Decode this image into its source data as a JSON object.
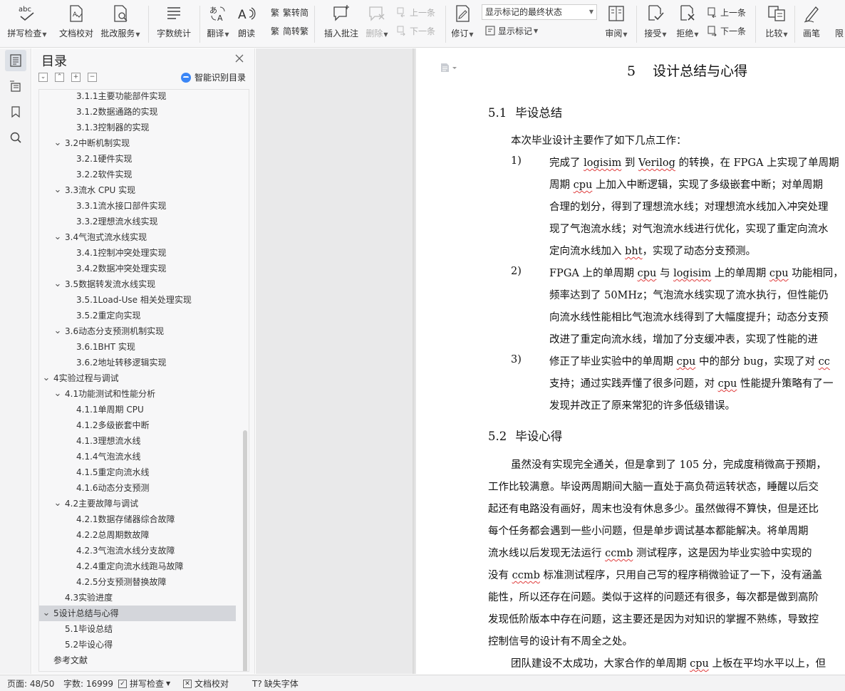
{
  "ribbon": {
    "buttons": [
      {
        "id": "spell",
        "label": "拼写检查",
        "caret": true,
        "icon": "spellcheck-icon"
      },
      {
        "id": "proof",
        "label": "文档校对",
        "caret": false,
        "icon": "document-proofread-icon"
      },
      {
        "id": "review_service",
        "label": "批改服务",
        "caret": true,
        "icon": "review-service-icon"
      },
      {
        "id": "word_count",
        "label": "字数统计",
        "caret": false,
        "icon": "word-count-icon"
      },
      {
        "id": "translate",
        "label": "翻译",
        "caret": true,
        "icon": "translate-icon"
      },
      {
        "id": "read_aloud",
        "label": "朗读",
        "caret": false,
        "icon": "read-aloud-icon"
      },
      {
        "id": "insert_comment",
        "label": "插入批注",
        "caret": false,
        "icon": "insert-comment-icon"
      },
      {
        "id": "delete",
        "label": "删除",
        "caret": true,
        "icon": "delete-comment-icon",
        "disabled": true
      },
      {
        "id": "track",
        "label": "修订",
        "caret": true,
        "icon": "track-changes-icon"
      },
      {
        "id": "review",
        "label": "审阅",
        "caret": true,
        "icon": "review-pane-icon"
      },
      {
        "id": "accept",
        "label": "接受",
        "caret": true,
        "icon": "accept-change-icon"
      },
      {
        "id": "reject",
        "label": "拒绝",
        "caret": true,
        "icon": "reject-change-icon"
      },
      {
        "id": "compare",
        "label": "比较",
        "caret": true,
        "icon": "compare-icon"
      },
      {
        "id": "pen",
        "label": "画笔",
        "caret": false,
        "icon": "pen-icon"
      },
      {
        "id": "restrict",
        "label": "限",
        "caret": false,
        "icon": ""
      }
    ],
    "trad": "繁转简",
    "simp": "简转繁",
    "prev_comment": "上一条",
    "next_comment": "下一条",
    "markup_select": "显示标记的最终状态",
    "show_markup": "显示标记",
    "prev_change": "上一条",
    "next_change": "下一条"
  },
  "toc": {
    "title": "目录",
    "smart_label": "智能识别目录",
    "ctrl": [
      "collapse-all",
      "expand-up",
      "add-heading",
      "remove-heading"
    ],
    "items": [
      {
        "label": "3.1.1主要功能部件实现",
        "level": 3,
        "toggle": ""
      },
      {
        "label": "3.1.2数据通路的实现",
        "level": 3,
        "toggle": ""
      },
      {
        "label": "3.1.3控制器的实现",
        "level": 3,
        "toggle": ""
      },
      {
        "label": "3.2中断机制实现",
        "level": 2,
        "toggle": "open"
      },
      {
        "label": "3.2.1硬件实现",
        "level": 3,
        "toggle": ""
      },
      {
        "label": "3.2.2软件实现",
        "level": 3,
        "toggle": ""
      },
      {
        "label": "3.3流水 CPU 实现",
        "level": 2,
        "toggle": "open"
      },
      {
        "label": "3.3.1流水接口部件实现",
        "level": 3,
        "toggle": ""
      },
      {
        "label": "3.3.2理想流水线实现",
        "level": 3,
        "toggle": ""
      },
      {
        "label": "3.4气泡式流水线实现",
        "level": 2,
        "toggle": "open"
      },
      {
        "label": "3.4.1控制冲突处理实现",
        "level": 3,
        "toggle": ""
      },
      {
        "label": "3.4.2数据冲突处理实现",
        "level": 3,
        "toggle": ""
      },
      {
        "label": "3.5数据转发流水线实现",
        "level": 2,
        "toggle": "open"
      },
      {
        "label": "3.5.1Load-Use 相关处理实现",
        "level": 3,
        "toggle": ""
      },
      {
        "label": "3.5.2重定向实现",
        "level": 3,
        "toggle": ""
      },
      {
        "label": "3.6动态分支预测机制实现",
        "level": 2,
        "toggle": "open"
      },
      {
        "label": "3.6.1BHT 实现",
        "level": 3,
        "toggle": ""
      },
      {
        "label": "3.6.2地址转移逻辑实现",
        "level": 3,
        "toggle": ""
      },
      {
        "label": "4实验过程与调试",
        "level": 1,
        "toggle": "open"
      },
      {
        "label": "4.1功能测试和性能分析",
        "level": 2,
        "toggle": "open"
      },
      {
        "label": "4.1.1单周期 CPU",
        "level": 3,
        "toggle": ""
      },
      {
        "label": "4.1.2多级嵌套中断",
        "level": 3,
        "toggle": ""
      },
      {
        "label": "4.1.3理想流水线",
        "level": 3,
        "toggle": ""
      },
      {
        "label": "4.1.4气泡流水线",
        "level": 3,
        "toggle": ""
      },
      {
        "label": "4.1.5重定向流水线",
        "level": 3,
        "toggle": ""
      },
      {
        "label": "4.1.6动态分支预测",
        "level": 3,
        "toggle": ""
      },
      {
        "label": "4.2主要故障与调试",
        "level": 2,
        "toggle": "open"
      },
      {
        "label": "4.2.1数据存储器综合故障",
        "level": 3,
        "toggle": ""
      },
      {
        "label": "4.2.2总周期数故障",
        "level": 3,
        "toggle": ""
      },
      {
        "label": "4.2.3气泡流水线分支故障",
        "level": 3,
        "toggle": ""
      },
      {
        "label": "4.2.4重定向流水线跑马故障",
        "level": 3,
        "toggle": ""
      },
      {
        "label": "4.2.5分支预测替换故障",
        "level": 3,
        "toggle": ""
      },
      {
        "label": "4.3实验进度",
        "level": 2,
        "toggle": ""
      },
      {
        "label": "5设计总结与心得",
        "level": 1,
        "toggle": "open",
        "selected": true
      },
      {
        "label": "5.1毕设总结",
        "level": 2,
        "toggle": ""
      },
      {
        "label": "5.2毕设心得",
        "level": 2,
        "toggle": ""
      },
      {
        "label": "参考文献",
        "level": 1,
        "toggle": ""
      }
    ]
  },
  "doc": {
    "chapter_num": "5",
    "chapter_title": "设计总结与心得",
    "s1_num": "5.1",
    "s1_title": "毕设总结",
    "s2_num": "5.2",
    "s2_title": "毕设心得",
    "intro": "本次毕业设计主要作了如下几点工作：",
    "list": [
      {
        "num": "1)",
        "lines": [
          "完成了 [logisim] 到 [Verilog] 的转换，在 FPGA 上实现了单周期",
          "周期 [cpu] 上加入中断逻辑，实现了多级嵌套中断；对单周期",
          "合理的划分，得到了理想流水线；对理想流水线加入冲突处理",
          "现了气泡流水线；对气泡流水线进行优化，实现了重定向流水",
          "定向流水线加入 [bht]，实现了动态分支预测。"
        ]
      },
      {
        "num": "2)",
        "lines": [
          "FPGA 上的单周期 [cpu] 与 [logisim] 上的单周期 [cpu] 功能相同，",
          "频率达到了 50MHz；气泡流水线实现了流水执行，但性能仍",
          "向流水线性能相比气泡流水线得到了大幅度提升；动态分支预",
          "改进了重定向流水线，增加了分支缓冲表，实现了性能的进"
        ]
      },
      {
        "num": "3)",
        "lines": [
          "修正了毕业实验中的单周期 [cpu] 中的部分 bug，实现了对 [cc]",
          "支持；通过实践弄懂了很多问题，对 [cpu] 性能提升策略有了一",
          "发现并改正了原来常犯的许多低级错误。"
        ]
      }
    ],
    "para2": [
      "虽然没有实现完全通关，但是拿到了 105 分，完成度稍微高于预期，",
      "工作比较满意。毕设两周期间大脑一直处于高负荷运转状态，睡醒以后交",
      "起还有电路没有画好，周末也没有休息多少。虽然做得不算快，但是还比",
      "每个任务都会遇到一些小问题，但是单步调试基本都能解决。将单周期",
      "流水线以后发现无法运行 [ccmb] 测试程序，这是因为毕业实验中实现的",
      "没有 [ccmb] 标准测试程序，只用自己写的程序稍微验证了一下，没有涵盖",
      "能性，所以还存在问题。类似于这样的问题还有很多，每次都是做到高阶",
      "发现低阶版本中存在问题，这主要还是因为对知识的掌握不熟练，导致控",
      "控制信号的设计有不周全之处。"
    ],
    "para3": "团队建设不太成功，大家合作的单周期 [cpu] 上板在平均水平以上，但"
  },
  "status": {
    "page": "页面: 48/50",
    "words": "字数: 16999",
    "spell": "拼写检查",
    "proof": "文档校对",
    "font": "缺失字体"
  }
}
